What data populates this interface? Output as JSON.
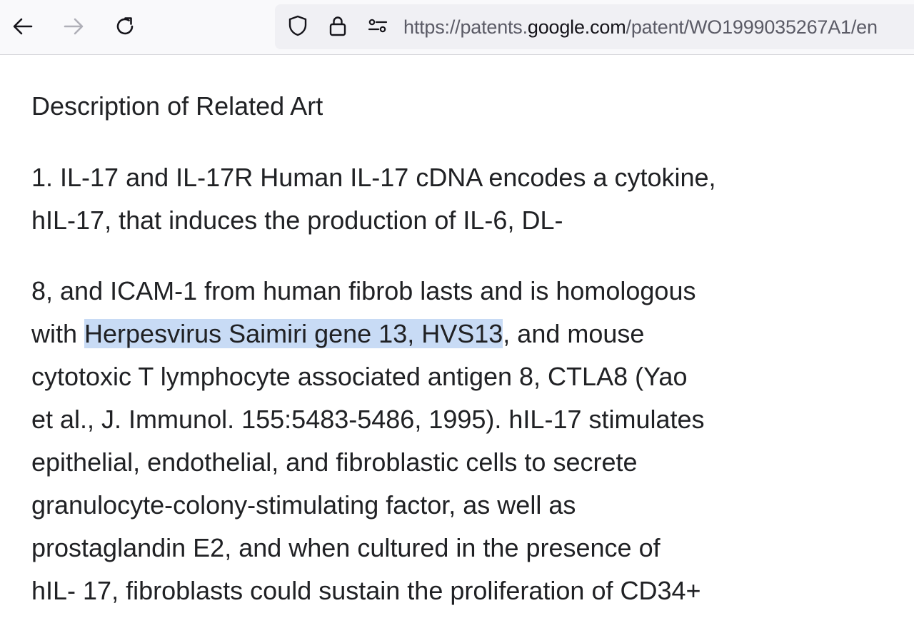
{
  "browser": {
    "back_icon": "arrow-left-icon",
    "forward_icon": "arrow-right-icon",
    "reload_icon": "reload-icon",
    "tracking_icon": "shield-icon",
    "lock_icon": "lock-icon",
    "permissions_icon": "permissions-icon",
    "url_prefix": "https://patents.",
    "url_host": "google.com",
    "url_suffix": "/patent/WO1999035267A1/en"
  },
  "page": {
    "heading": "Description of Related Art",
    "paragraph1": {
      "line1": "1. IL-17 and IL-17R Human IL-17 cDNA encodes a cytokine,",
      "line2": "hIL-17, that induces the production of IL-6, DL-"
    },
    "paragraph2": {
      "line1": "8, and ICAM-1 from human fibrob lasts and is homologous",
      "line2_before": "with ",
      "line2_highlight": "Herpesvirus Saimiri gene 13, HVS13",
      "line2_after": ", and mouse",
      "line3": "cytotoxic T lymphocyte associated antigen 8, CTLA8 (Yao",
      "line4": "et al., J. Immunol. 155:5483-5486, 1995). hIL-17 stimulates",
      "line5": "epithelial, endothelial, and fibroblastic cells to secrete",
      "line6": "granulocyte-colony-stimulating factor, as well as",
      "line7": "prostaglandin E2, and when cultured in the presence of",
      "line8": "hIL- 17, fibroblasts could sustain the proliferation of CD34+"
    },
    "highlight_color": "#c8dbf5"
  }
}
